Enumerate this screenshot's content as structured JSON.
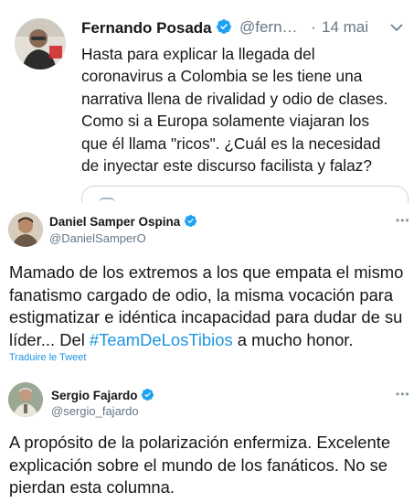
{
  "tweet1": {
    "author_name": "Fernando Posada",
    "handle": "@fern…",
    "separator": "·",
    "date": "14 mai",
    "text_lines": [
      "Hasta para explicar la llegada del",
      "coronavirus a Colombia se les tiene una",
      "narrativa llena de rivalidad y odio de clases.",
      "Como si a Europa solamente viajaran los",
      "que él llama \"ricos\". ¿Cuál es la necesidad",
      "de inyectar este discurso facilista y falaz?"
    ]
  },
  "tweet2": {
    "author_name": "Daniel Samper Ospina",
    "handle": "@DanielSamperO",
    "more": "•••",
    "text_lines": [
      "Mamado de los extremos a los que empata el mismo",
      "fanatismo cargado de odio, la misma vocación para",
      "estigmatizar e idéntica incapacidad para dudar de su"
    ],
    "last_line_before": "líder... Del ",
    "hashtag": "#TeamDeLosTibios",
    "last_line_after": " a mucho honor.",
    "translate_label": "Traduire le Tweet"
  },
  "tweet3": {
    "author_name": "Sergio Fajardo",
    "handle": "@sergio_fajardo",
    "more": "•••",
    "text_lines": [
      "A propósito de la polarización enfermiza. Excelente",
      "explicación sobre el mundo de los fanáticos. No se",
      "pierdan esta columna."
    ]
  },
  "colors": {
    "verified_blue": "#1da1f2",
    "link_blue": "#1b95e0",
    "secondary_gray": "#657786"
  }
}
